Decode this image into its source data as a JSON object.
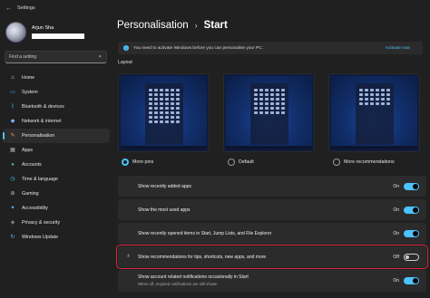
{
  "window": {
    "title": "Settings"
  },
  "profile": {
    "name": "Arjun Sha"
  },
  "search": {
    "placeholder": "Find a setting"
  },
  "sidebar": {
    "items": [
      {
        "label": "Home",
        "icon": "home-icon",
        "glyph": "⌂",
        "color": "#e0e0e0"
      },
      {
        "label": "System",
        "icon": "monitor-icon",
        "glyph": "▭",
        "color": "#4cc2ff"
      },
      {
        "label": "Bluetooth & devices",
        "icon": "bluetooth-icon",
        "glyph": "ᛒ",
        "color": "#4cc2ff"
      },
      {
        "label": "Network & internet",
        "icon": "wifi-icon",
        "glyph": "◆",
        "color": "#79b8ff"
      },
      {
        "label": "Personalisation",
        "icon": "brush-icon",
        "glyph": "✎",
        "color": "#e0a050",
        "active": true
      },
      {
        "label": "Apps",
        "icon": "apps-icon",
        "glyph": "▦",
        "color": "#b5b5b5"
      },
      {
        "label": "Accounts",
        "icon": "person-icon",
        "glyph": "●",
        "color": "#3fc07a"
      },
      {
        "label": "Time & language",
        "icon": "globe-clock-icon",
        "glyph": "◷",
        "color": "#4cc2ff"
      },
      {
        "label": "Gaming",
        "icon": "gamepad-icon",
        "glyph": "⊕",
        "color": "#b5b5b5"
      },
      {
        "label": "Accessibility",
        "icon": "accessibility-icon",
        "glyph": "✦",
        "color": "#4cc2ff"
      },
      {
        "label": "Privacy & security",
        "icon": "shield-icon",
        "glyph": "◈",
        "color": "#9a9a9a"
      },
      {
        "label": "Windows Update",
        "icon": "update-icon",
        "glyph": "↻",
        "color": "#4cc2ff"
      }
    ]
  },
  "breadcrumb": {
    "parent": "Personalisation",
    "separator": "›",
    "current": "Start"
  },
  "banner": {
    "text": "You need to activate Windows before you can personalise your PC.",
    "action": "Activate now"
  },
  "layout": {
    "label": "Layout",
    "options": [
      {
        "label": "More pins",
        "selected": true
      },
      {
        "label": "Default",
        "selected": false
      },
      {
        "label": "More recommendations",
        "selected": false
      }
    ]
  },
  "settings": [
    {
      "label": "Show recently added apps",
      "state_label": "On",
      "on": true
    },
    {
      "label": "Show the most used apps",
      "state_label": "On",
      "on": true
    },
    {
      "label": "Show recently opened items in Start, Jump Lists, and File Explorer",
      "state_label": "On",
      "on": true
    },
    {
      "label": "Show recommendations for tips, shortcuts, new apps, and more",
      "state_label": "Off",
      "on": false,
      "icon": "lightbulb-icon",
      "highlighted": true
    },
    {
      "label": "Show account related notifications occasionally in Start",
      "subtext": "When off, required notifications are still shown",
      "state_label": "On",
      "on": true
    }
  ],
  "colors": {
    "accent": "#4cc2ff",
    "highlight": "#d7263d",
    "background": "#202020",
    "card": "#2b2b2b"
  }
}
